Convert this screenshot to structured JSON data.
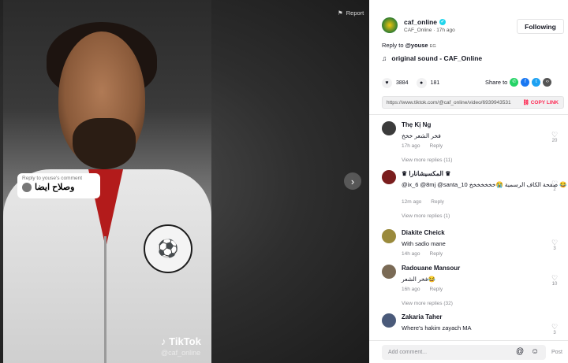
{
  "video": {
    "report_label": "Report",
    "reply_card_title": "Reply to youse's comment",
    "reply_card_text": "وصلاح ايضا",
    "watermark_brand": "TikTok",
    "watermark_handle": "@caf_online"
  },
  "author": {
    "name": "caf_online",
    "display_name": "CAF_Online",
    "time": "17h ago",
    "follow_label": "Following",
    "reply_prefix": "Reply to",
    "reply_user": "@youse",
    "reply_country": "EG",
    "sound": "original sound - CAF_Online"
  },
  "stats": {
    "likes": "3884",
    "comments": "181",
    "share_label": "Share to"
  },
  "link": {
    "url": "https://www.tiktok.com/@caf_online/video/6939943531",
    "copy_label": "COPY LINK"
  },
  "comments": [
    {
      "user": "Thẹ Kị Ng",
      "text": "فخر الشعر خخخ",
      "time": "17h ago",
      "reply": "Reply",
      "likes": "20",
      "view_replies": "View more replies (11)",
      "avatar_color": "#3b3b3b"
    },
    {
      "user": "♛ المكسيشانارا ♛",
      "text": "@ix_6 @8mj @santa_10 صفحة الكاف الرسمية 😭خخخخخخخ 😂",
      "time": "12m ago",
      "reply": "Reply",
      "likes": "2",
      "view_replies": "View more replies (1)",
      "avatar_color": "#7a1d1d"
    },
    {
      "user": "Diakite Cheick",
      "text": "With sadio mane",
      "time": "14h ago",
      "reply": "Reply",
      "likes": "3",
      "view_replies": "",
      "avatar_color": "#9a8a3c"
    },
    {
      "user": "Radouane Mansour",
      "text": "فخر الشعر😂",
      "time": "16h ago",
      "reply": "Reply",
      "likes": "10",
      "view_replies": "View more replies (32)",
      "avatar_color": "#7a6a55"
    },
    {
      "user": "Zakaria Taher",
      "text": "Where's hakim zayach MA",
      "time": "",
      "reply": "",
      "likes": "3",
      "view_replies": "",
      "avatar_color": "#4a5a7a"
    }
  ],
  "input": {
    "placeholder": "Add comment...",
    "post_label": "Post"
  }
}
